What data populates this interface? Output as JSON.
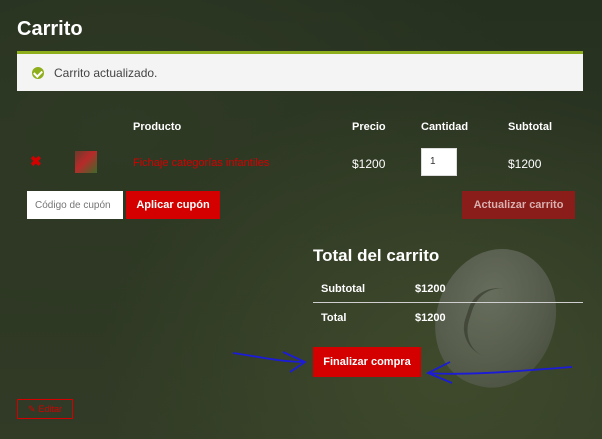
{
  "page": {
    "title": "Carrito"
  },
  "notice": {
    "message": "Carrito actualizado.",
    "accent": "#8fae1b"
  },
  "cart": {
    "headers": {
      "product": "Producto",
      "price": "Precio",
      "quantity": "Cantidad",
      "subtotal": "Subtotal"
    },
    "items": [
      {
        "remove_symbol": "✖",
        "name": "Fichaje categorías infantiles",
        "price": "$1200",
        "quantity": "1",
        "subtotal": "$1200"
      }
    ],
    "coupon_placeholder": "Código de cupón",
    "apply_coupon_label": "Aplicar cupón",
    "update_cart_label": "Actualizar carrito"
  },
  "totals": {
    "title": "Total del carrito",
    "subtotal_label": "Subtotal",
    "subtotal_value": "$1200",
    "total_label": "Total",
    "total_value": "$1200",
    "checkout_label": "Finalizar compra"
  },
  "edit": {
    "label": "Editar",
    "icon": "pencil-icon"
  },
  "colors": {
    "brand_red": "#d40000",
    "annotation_blue": "#1b1bd8"
  }
}
